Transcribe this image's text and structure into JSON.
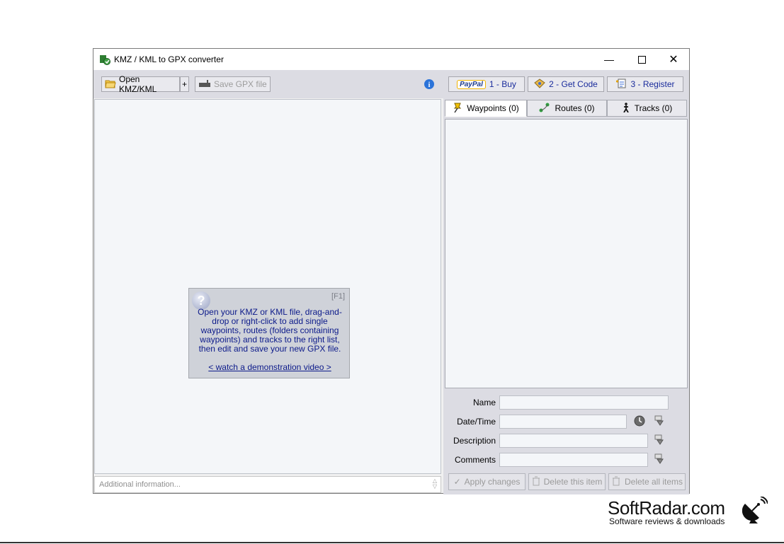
{
  "window": {
    "title": "KMZ / KML to GPX converter",
    "minimize_icon": "minimize-icon",
    "maximize_icon": "maximize-icon",
    "close_icon": "close-icon"
  },
  "toolbar": {
    "open_label": "Open KMZ/KML",
    "plus_label": "+",
    "save_label": "Save GPX file",
    "buy_label": "1 - Buy",
    "paypal_label": "PayPal",
    "get_code_label": "2 - Get Code",
    "register_label": "3 - Register"
  },
  "help": {
    "shortcut": "[F1]",
    "question_mark": "?",
    "text": "Open your KMZ or KML file, drag-and-drop or right-click to add single waypoints, routes (folders containing waypoints) and tracks to the right list, then edit and save your new GPX file.",
    "link": "<  watch a demonstration video  >"
  },
  "info": {
    "placeholder": "Additional information..."
  },
  "tabs": [
    {
      "label": "Waypoints (0)"
    },
    {
      "label": "Routes (0)"
    },
    {
      "label": "Tracks (0)"
    }
  ],
  "fields": {
    "name_label": "Name",
    "datetime_label": "Date/Time",
    "description_label": "Description",
    "comments_label": "Comments"
  },
  "actions": {
    "apply_label": "Apply changes",
    "delete_item_label": "Delete this item",
    "delete_all_label": "Delete all items"
  },
  "watermark": {
    "brand": "SoftRadar.com",
    "tagline": "Software reviews & downloads"
  }
}
